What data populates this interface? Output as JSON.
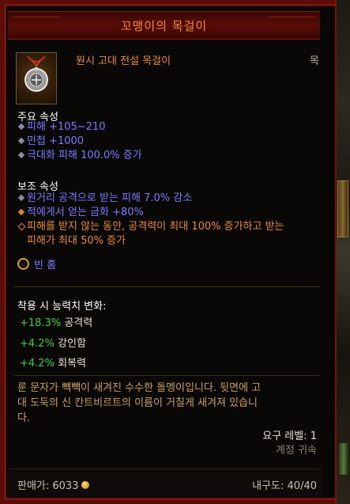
{
  "title": "꼬맹이의 목걸이",
  "item": {
    "type_name": "원시 고대 전설 목걸이",
    "slot": "목",
    "icon": "amulet-icon"
  },
  "primary": {
    "heading": "주요 속성",
    "stats": [
      "피해 +105~210",
      "민첩 +1000",
      "극대화 피해 100.0% 증가"
    ]
  },
  "secondary": {
    "heading": "보조 속성",
    "stats": [
      "원거리 공격으로 받는 피해 7.0% 감소",
      "적에게서 얻는 금화 +80%",
      "피해를 받지 않는 동안, 공격력이 최대 100% 증가하고 받는",
      "피해가 최대 50% 증가"
    ]
  },
  "socket": {
    "label": "빈 홈"
  },
  "equip_changes": {
    "heading": "착용 시 능력치 변화:",
    "rows": [
      {
        "value": "+18.3%",
        "label": "공격력"
      },
      {
        "value": "+4.2%",
        "label": "강인함"
      },
      {
        "value": "+4.2%",
        "label": "회복력"
      }
    ]
  },
  "flavor": {
    "line1": "룬 문자가 빽빽이 새겨진 수수한 돌멩이입니다. 뒷면에 고",
    "line2": "대 도둑의 신 칸트비르트의 이름이 거칠게 새겨져 있습니",
    "line3": "다."
  },
  "requirements": {
    "level": "요구 레벨: 1",
    "bound": "계정 귀속"
  },
  "footer": {
    "sell_price": "판매가: 6033",
    "durability": "내구도: 40/40"
  },
  "colors": {
    "legendary": "#e88a3a",
    "magic": "#7a7aff",
    "positive": "#3ccf3c",
    "frame": "#5e0c08"
  }
}
